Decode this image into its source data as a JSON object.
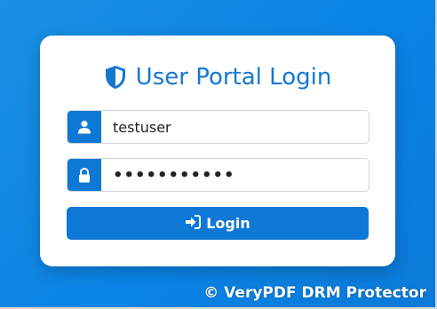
{
  "login": {
    "title": "User Portal Login",
    "username_value": "testuser",
    "password_value": "•••••••••••",
    "button_label": "Login"
  },
  "watermark": "© VeryPDF DRM Protector",
  "icons": {
    "title": "shield-icon",
    "username": "user-icon",
    "password": "lock-icon",
    "button": "sign-in-icon"
  },
  "colors": {
    "background": "#0a84e6",
    "accent": "#1578d0",
    "button": "#0f78d6",
    "card": "#ffffff"
  }
}
